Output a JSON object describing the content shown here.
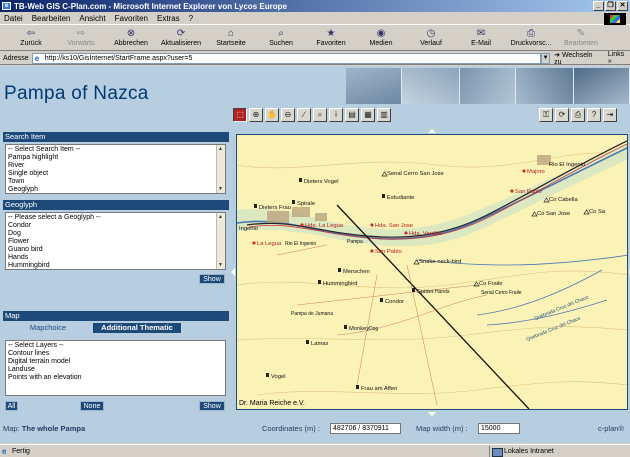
{
  "window": {
    "title": "TB-Web GIS C-Plan.com - Microsoft Internet Explorer von Lycos Europe",
    "buttons": [
      "_",
      "❐",
      "✕"
    ]
  },
  "menu": [
    "Datei",
    "Bearbeiten",
    "Ansicht",
    "Favoriten",
    "Extras",
    "?"
  ],
  "toolbar": [
    {
      "label": "Zurück",
      "icon": "back-arrow-icon",
      "glyph": "⇦",
      "enabled": true
    },
    {
      "label": "Vorwärts",
      "icon": "forward-arrow-icon",
      "glyph": "⇨",
      "enabled": false
    },
    {
      "label": "Abbrechen",
      "icon": "stop-icon",
      "glyph": "⊗",
      "enabled": true
    },
    {
      "label": "Aktualisieren",
      "icon": "refresh-icon",
      "glyph": "⟳",
      "enabled": true
    },
    {
      "label": "Startseite",
      "icon": "home-icon",
      "glyph": "⌂",
      "enabled": true
    },
    {
      "label": "Suchen",
      "icon": "search-icon",
      "glyph": "⌕",
      "enabled": true
    },
    {
      "label": "Favoriten",
      "icon": "favorites-icon",
      "glyph": "★",
      "enabled": true
    },
    {
      "label": "Medien",
      "icon": "media-icon",
      "glyph": "◉",
      "enabled": true
    },
    {
      "label": "Verlauf",
      "icon": "history-icon",
      "glyph": "◷",
      "enabled": true
    },
    {
      "label": "E-Mail",
      "icon": "mail-icon",
      "glyph": "✉",
      "enabled": true
    },
    {
      "label": "Druckvorsc...",
      "icon": "print-preview-icon",
      "glyph": "⎙",
      "enabled": true
    },
    {
      "label": "Bearbeiten",
      "icon": "edit-icon",
      "glyph": "✎",
      "enabled": false
    }
  ],
  "address": {
    "label": "Adresse",
    "url": "http://ks10/GisInternet/StartFrame.aspx?user=5",
    "go_label": "Wechseln zu",
    "links_label": "Links"
  },
  "page": {
    "title": "Pampa of Nazca",
    "search_item": {
      "header": "Search Item",
      "options": [
        "-- Select Search Item --",
        "Pampa highlight",
        "River",
        "Single object",
        "Town",
        "Geoglyph"
      ]
    },
    "geoglyph": {
      "header": "Geoglyph",
      "options": [
        "-- Please select a Geoglyph --",
        "Condor",
        "Dog",
        "Flower",
        "Guano bird",
        "Hands",
        "Hummingbird"
      ],
      "show_label": "Show"
    },
    "map_panel": {
      "header": "Map",
      "tabs": [
        "Mapchoice",
        "Additional Thematic"
      ],
      "layers": [
        "-- Select Layers --",
        "Contour lines",
        "Digital terrain model",
        "Landuse",
        "Points with an elevation"
      ],
      "all_label": "All",
      "none_label": "None",
      "show_label": "Show"
    },
    "map_label": "Map:",
    "map_name": "The whole Pampa",
    "coordinates_label": "Coordinates (m) :",
    "coordinates_value": "482706 / 8370911",
    "map_width_label": "Map width (m) :",
    "map_width_value": "15000",
    "cplan": "c-plan®",
    "map_tools": [
      "zoom-rect-icon",
      "zoom-in-icon",
      "pan-hand-icon",
      "zoom-out-icon",
      "measure-icon",
      "search-map-icon",
      "info-icon",
      "layers-icon",
      "legend-icon",
      "table-icon"
    ],
    "map_tools_right": [
      "lock-icon",
      "refresh-map-icon",
      "print-icon",
      "help-icon",
      "export-icon"
    ],
    "map": {
      "credit": "Dr. Maria Reiche e.V.",
      "labels": [
        {
          "text": "Dieters Vogel"
        },
        {
          "text": "Senal Cerro San Jose"
        },
        {
          "text": "Rio El Ingenio"
        },
        {
          "text": "Majoro"
        },
        {
          "text": "Dieters Frau"
        },
        {
          "text": "Spirale"
        },
        {
          "text": "Estudiante"
        },
        {
          "text": "San Pablo"
        },
        {
          "text": "Co Cabella"
        },
        {
          "text": "Co San Jose"
        },
        {
          "text": "Co Sa"
        },
        {
          "text": "Ingenio"
        },
        {
          "text": "Hda. La Legua"
        },
        {
          "text": "Hda. San Jose"
        },
        {
          "text": "Hda. Verdilla"
        },
        {
          "text": "La Legua"
        },
        {
          "text": "Rio El Ingenio"
        },
        {
          "text": "Pampa"
        },
        {
          "text": "San Pablo"
        },
        {
          "text": "Snake-neck-bird"
        },
        {
          "text": "Menschen"
        },
        {
          "text": "Hummingbird"
        },
        {
          "text": "Co Fraile"
        },
        {
          "text": "Senal Cerro Fraile"
        },
        {
          "text": "Spider"
        },
        {
          "text": "Hands"
        },
        {
          "text": "Condor"
        },
        {
          "text": "Quebrada Cruz del Chaco"
        },
        {
          "text": "Quebrada Cruz del Chaco"
        },
        {
          "text": "Pampa de Jumana"
        },
        {
          "text": "Monkey"
        },
        {
          "text": "Dog"
        },
        {
          "text": "Lamas"
        },
        {
          "text": "Vogel"
        },
        {
          "text": "Frau am Affen"
        }
      ]
    }
  },
  "status": {
    "text": "Fertig",
    "zone": "Lokales Intranet"
  }
}
